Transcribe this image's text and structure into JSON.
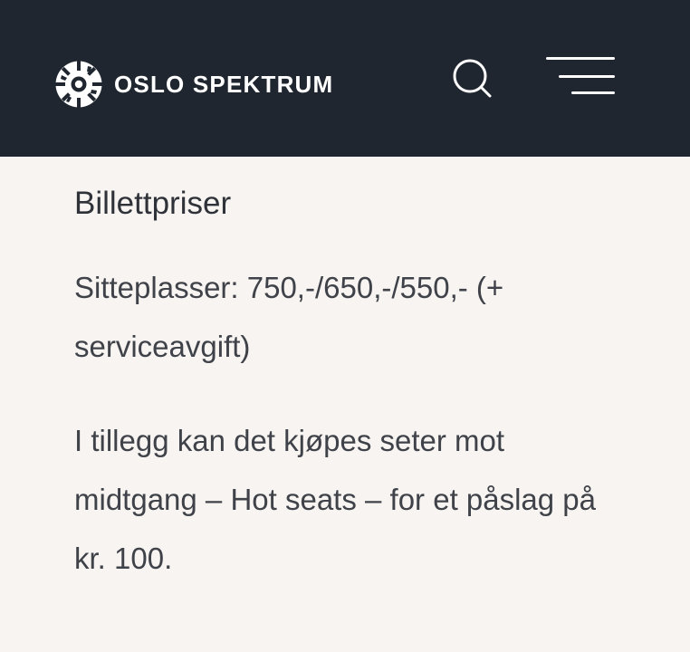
{
  "header": {
    "brand": "OSLO SPEKTRUM",
    "search_icon": "search-icon",
    "menu_icon": "hamburger-menu-icon",
    "background": "#1f262f"
  },
  "content": {
    "heading": "Billettpriser",
    "paragraphs": [
      "Sitteplasser: 750,-/650,-/550,- (+ serviceavgift)",
      "I tillegg kan det kjøpes seter mot midtgang – Hot seats – for et påslag på kr. 100."
    ]
  },
  "colors": {
    "page_background": "#f7f4f1",
    "text": "#3f4249"
  }
}
